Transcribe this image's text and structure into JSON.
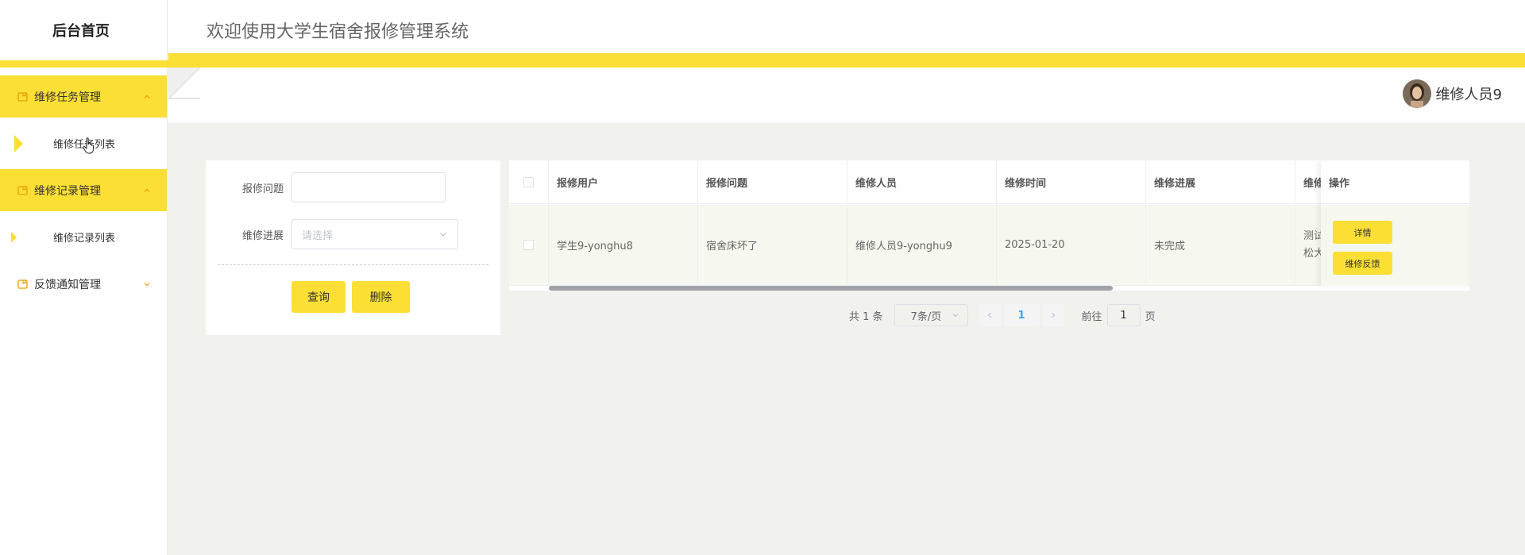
{
  "sidebar": {
    "brand": "后台首页",
    "groups": [
      {
        "label": "维修任务管理",
        "sub": "维修任务列表"
      },
      {
        "label": "维修记录管理",
        "sub": "维修记录列表"
      },
      {
        "label": "反馈通知管理"
      }
    ]
  },
  "header": {
    "title": "欢迎使用大学生宿舍报修管理系统"
  },
  "user": {
    "name": "维修人员9"
  },
  "search": {
    "issue_label": "报修问题",
    "issue_value": "",
    "progress_label": "维修进展",
    "progress_placeholder": "请选择",
    "query_button": "查询",
    "delete_button": "删除"
  },
  "table": {
    "columns": [
      "报修用户",
      "报修问题",
      "维修人员",
      "维修时间",
      "维修进展",
      "维修",
      "操作"
    ],
    "rows": [
      {
        "user": "学生9-yonghu8",
        "issue": "宿舍床坏了",
        "staff": "维修人员9-yonghu9",
        "time": "2025-01-20",
        "progress": "未完成",
        "detail_line1": "测试",
        "detail_line2": "松大"
      }
    ],
    "actions": {
      "detail": "详情",
      "feedback": "维修反馈"
    }
  },
  "pagination": {
    "total": "共 1 条",
    "page_size": "7条/页",
    "current": "1",
    "goto_label": "前往",
    "goto_value": "1",
    "page_suffix": "页"
  },
  "colors": {
    "accent": "#fcdf35"
  },
  "icons": {
    "menu": "folder-icon",
    "chevron_up": "chevron-up-icon",
    "chevron_down": "chevron-down-icon"
  }
}
